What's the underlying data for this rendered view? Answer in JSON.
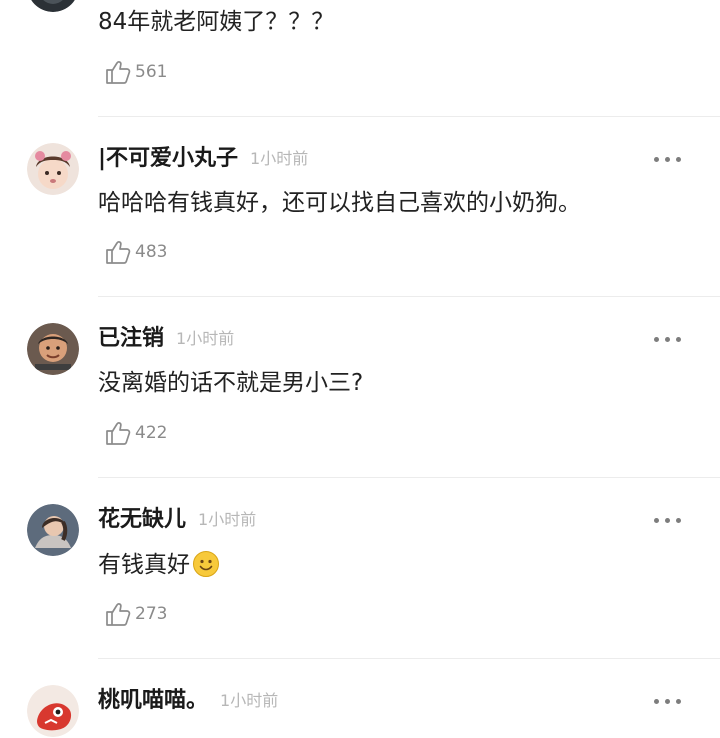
{
  "comments": [
    {
      "username": "",
      "time": "",
      "text": "84年就老阿姨了？？？",
      "likes": "561"
    },
    {
      "username": "|不可爱小丸子",
      "time": "1小时前",
      "text": "哈哈哈有钱真好，还可以找自己喜欢的小奶狗。",
      "likes": "483"
    },
    {
      "username": "已注销",
      "time": "1小时前",
      "text": "没离婚的话不就是男小三?",
      "likes": "422"
    },
    {
      "username": "花无缺儿",
      "time": "1小时前",
      "text": "有钱真好",
      "text_emoji": "smile-emoji",
      "likes": "273"
    },
    {
      "username": "桃叽喵喵。",
      "time": "1小时前",
      "text": "",
      "likes": ""
    }
  ],
  "icons": {
    "like": "thumbs-up-icon",
    "more": "more-dots-icon"
  },
  "colors": {
    "username": "#1a1a1a",
    "time": "#b7b7b7",
    "text": "#222222",
    "like_count": "#8a8a8a",
    "divider": "#ececec",
    "background": "#ffffff"
  }
}
